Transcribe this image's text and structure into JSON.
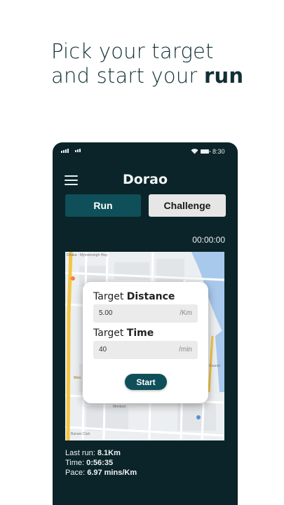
{
  "headline": {
    "line1": "Pick your target",
    "line2_prefix": "and start your ",
    "line2_bold": "run"
  },
  "status_bar": {
    "time": "8:30",
    "icons": [
      "signal-icon",
      "signal-icon",
      "wifi-icon",
      "battery-icon"
    ]
  },
  "app": {
    "title": "Dorao",
    "menu_icon": "hamburger-menu-icon"
  },
  "tabs": [
    {
      "label": "Run",
      "active": true
    },
    {
      "label": "Challenge",
      "active": false
    }
  ],
  "timer": "00:00:00",
  "target_card": {
    "distance_label_prefix": "Target ",
    "distance_label_bold": "Distance",
    "distance_value": "5.00",
    "distance_unit": "/Km",
    "time_label_prefix": "Target ",
    "time_label_bold": "Time",
    "time_value": "40",
    "time_unit": "/min",
    "start_label": "Start"
  },
  "map": {
    "labels": [
      "Dhaka - Mymensingh Hwy",
      "Mentors'",
      "Banani Club",
      "Woo",
      "Courier"
    ]
  },
  "stats": {
    "last_run_label": "Last run: ",
    "last_run_value": "8.1Km",
    "time_label": "Time: ",
    "time_value": "0:56:35",
    "pace_label": "Pace: ",
    "pace_value": "6.97 mins/Km"
  },
  "colors": {
    "phone_bg": "#0b2429",
    "accent": "#0f4f59",
    "inactive_tab": "#e6e6e6"
  }
}
